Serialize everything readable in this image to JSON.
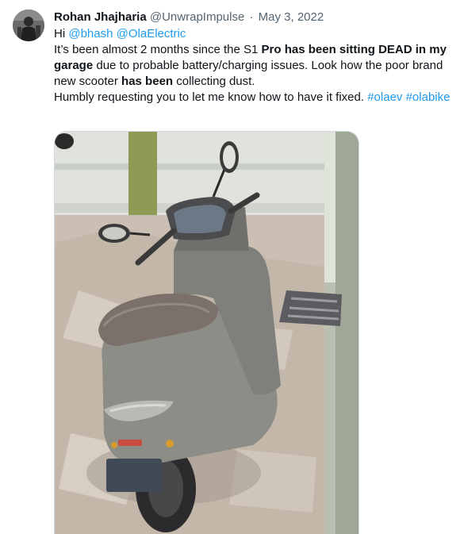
{
  "tweet": {
    "display_name": "Rohan Jhajharia",
    "handle": "@UnwrapImpulse",
    "separator": "·",
    "date": "May 3, 2022",
    "line1": {
      "prefix": "Hi ",
      "mention1": "@bhash",
      "space": " ",
      "mention2": "@OlaElectric"
    },
    "para1": {
      "t1": "It’s been almost 2 months since the S1 ",
      "b1": "Pro has been sitting DEAD in my garage",
      "t2": " due to probable battery/charging issues. Look how the poor brand new scooter ",
      "b2": "has been",
      "t3": " collecting dust."
    },
    "para2": {
      "t1": "Humbly requesting you to let me know how to have it fixed. ",
      "hashtag1": "#olaev",
      "space": " ",
      "hashtag2": "#olabike"
    }
  },
  "icons": {
    "avatar": "user-avatar-photo",
    "media": "dusty-scooter-photo"
  },
  "colors": {
    "text": "#0f1419",
    "secondary": "#536471",
    "link": "#1d9bf0",
    "border": "#cfd9de"
  }
}
